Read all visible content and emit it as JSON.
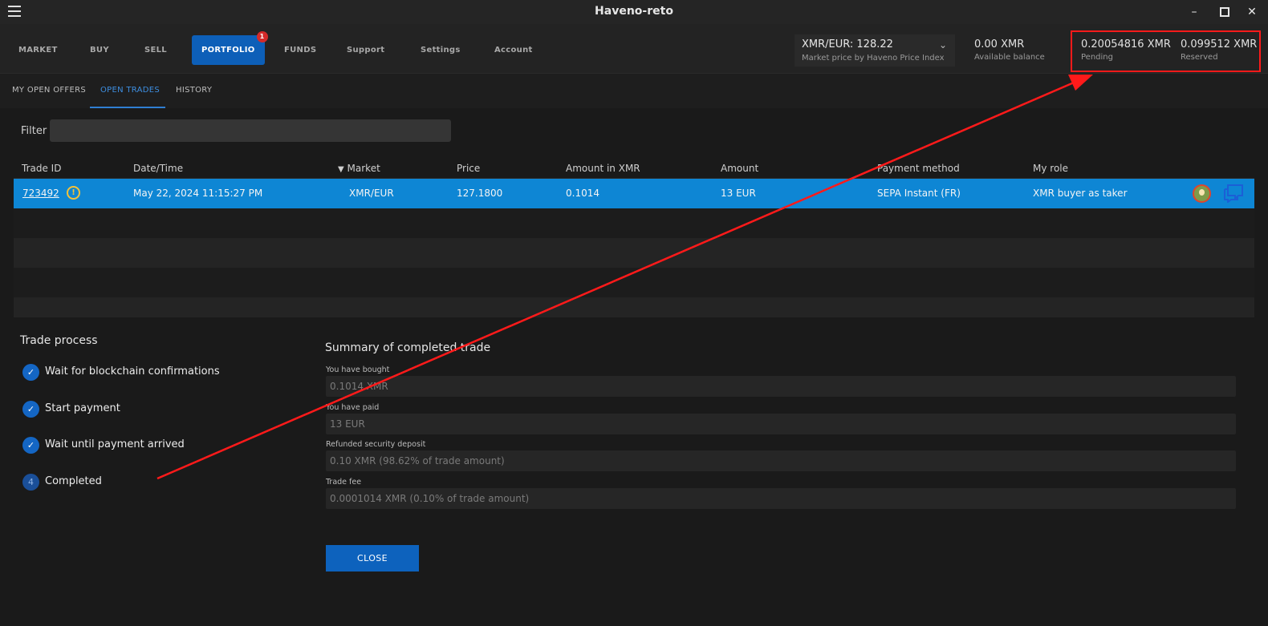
{
  "window": {
    "title": "Haveno-reto"
  },
  "nav": {
    "items": [
      "MARKET",
      "BUY",
      "SELL",
      "PORTFOLIO",
      "FUNDS",
      "Support",
      "Settings",
      "Account"
    ],
    "portfolio_badge": "1"
  },
  "header": {
    "price_value": "XMR/EUR: 128.22",
    "price_label": "Market price by Haveno Price Index",
    "available_value": "0.00 XMR",
    "available_label": "Available balance",
    "pending_value": "0.20054816 XMR",
    "pending_label": "Pending",
    "reserved_value": "0.099512 XMR",
    "reserved_label": "Reserved"
  },
  "subtabs": [
    "MY OPEN OFFERS",
    "OPEN TRADES",
    "HISTORY"
  ],
  "filter": {
    "label": "Filter",
    "value": ""
  },
  "table": {
    "headers": [
      "Trade ID",
      "Date/Time",
      "Market",
      "Price",
      "Amount in XMR",
      "Amount",
      "Payment method",
      "My role"
    ],
    "sort_indicator": "▼",
    "rows": [
      {
        "trade_id": "723492",
        "datetime": "May 22, 2024 11:15:27 PM",
        "market": "XMR/EUR",
        "price": "127.1800",
        "amount_xmr": "0.1014",
        "amount": "13 EUR",
        "payment_method": "SEPA Instant (FR)",
        "role": "XMR buyer as taker"
      }
    ]
  },
  "trade_process": {
    "title": "Trade process",
    "steps": [
      {
        "label": "Wait for blockchain confirmations",
        "marker": "✓"
      },
      {
        "label": "Start payment",
        "marker": "✓"
      },
      {
        "label": "Wait until payment arrived",
        "marker": "✓"
      },
      {
        "label": "Completed",
        "marker": "4"
      }
    ]
  },
  "summary": {
    "title": "Summary of completed trade",
    "fields": [
      {
        "label": "You have bought",
        "value": "0.1014 XMR"
      },
      {
        "label": "You have paid",
        "value": "13 EUR"
      },
      {
        "label": "Refunded security deposit",
        "value": "0.10 XMR (98.62% of trade amount)"
      },
      {
        "label": "Trade fee",
        "value": "0.0001014 XMR (0.10% of trade amount)"
      }
    ],
    "close_label": "CLOSE"
  },
  "colors": {
    "accent": "#0d62bd",
    "selected_row": "#0e86d4",
    "annotation": "#ff1a1a",
    "warning": "#f2c23a"
  }
}
